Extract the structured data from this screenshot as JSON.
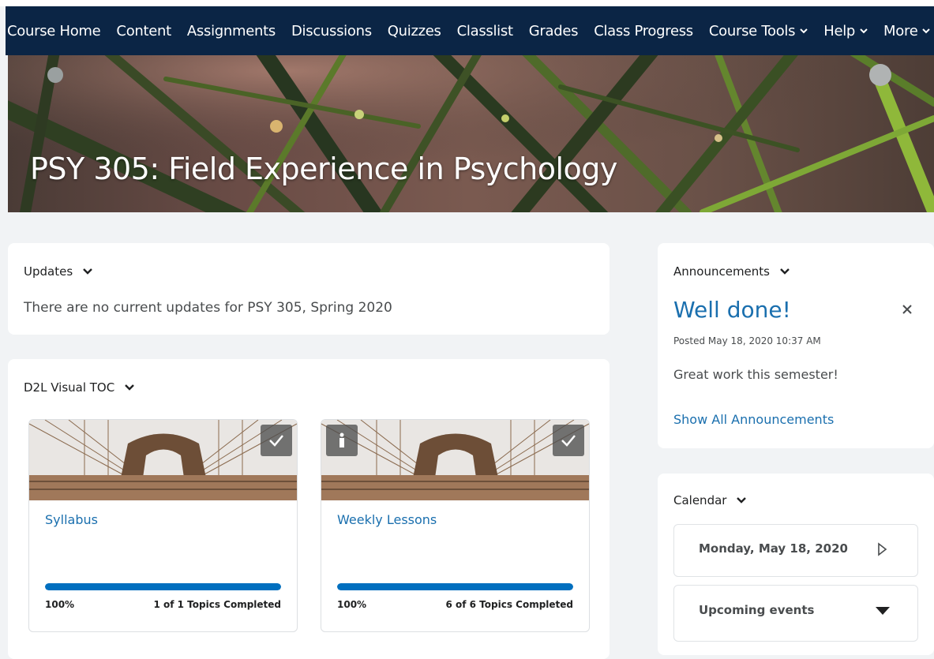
{
  "nav": {
    "items": [
      {
        "label": "Course Home",
        "dropdown": false
      },
      {
        "label": "Content",
        "dropdown": false
      },
      {
        "label": "Assignments",
        "dropdown": false
      },
      {
        "label": "Discussions",
        "dropdown": false
      },
      {
        "label": "Quizzes",
        "dropdown": false
      },
      {
        "label": "Classlist",
        "dropdown": false
      },
      {
        "label": "Grades",
        "dropdown": false
      },
      {
        "label": "Class Progress",
        "dropdown": false
      },
      {
        "label": "Course Tools",
        "dropdown": true
      },
      {
        "label": "Help",
        "dropdown": true
      },
      {
        "label": "More",
        "dropdown": true
      }
    ]
  },
  "banner": {
    "title": "PSY 305: Field Experience in Psychology"
  },
  "updates": {
    "heading": "Updates",
    "message": "There are no current updates for PSY 305, Spring 2020"
  },
  "toc": {
    "heading": "D2L Visual TOC",
    "modules": [
      {
        "title": "Syllabus",
        "progress_percent": 100,
        "progress_label": "100%",
        "topics_label": "1 of 1 Topics Completed",
        "badges": [
          "checkmark-icon"
        ]
      },
      {
        "title": "Weekly Lessons",
        "progress_percent": 100,
        "progress_label": "100%",
        "topics_label": "6 of 6 Topics Completed",
        "badges": [
          "info-icon",
          "checkmark-icon"
        ]
      }
    ]
  },
  "announcements": {
    "heading": "Announcements",
    "title": "Well done!",
    "posted": "Posted May 18, 2020 10:37 AM",
    "body": "Great work this semester!",
    "show_all": "Show All Announcements"
  },
  "calendar": {
    "heading": "Calendar",
    "date": "Monday, May 18, 2020",
    "upcoming": "Upcoming events"
  },
  "colors": {
    "nav_bg": "#0b2545",
    "link": "#1a6fae",
    "progress": "#006fbf",
    "page_bg": "#f1f3f5"
  }
}
